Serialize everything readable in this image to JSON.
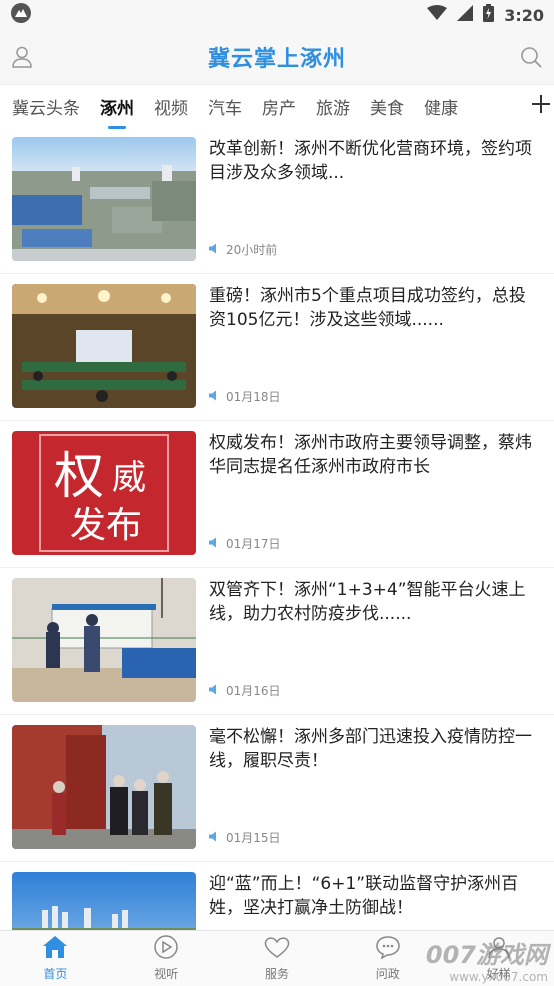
{
  "status_bar": {
    "time": "3:20"
  },
  "header": {
    "title": "冀云掌上涿州"
  },
  "tabs": [
    "冀云头条",
    "涿州",
    "视频",
    "汽车",
    "房产",
    "旅游",
    "美食",
    "健康"
  ],
  "articles": [
    {
      "title": "改革创新！涿州不断优化营商环境，签约项目涉及众多领域...",
      "time": "20小时前",
      "thumb_icon": "aerial-industrial-park-photo"
    },
    {
      "title": "重磅！涿州市5个重点项目成功签约，总投资105亿元！涉及这些领域......",
      "time": "01月18日",
      "thumb_icon": "conference-hall-photo"
    },
    {
      "title": "权威发布！涿州市政府主要领导调整，蔡炜华同志提名任涿州市政府市长",
      "time": "01月17日",
      "thumb_icon": "authority-release-banner",
      "thumb_text": [
        "权",
        "威",
        "发布"
      ]
    },
    {
      "title": "双管齐下！涿州“1+3+4”智能平台火速上线，助力农村防疫步伐......",
      "time": "01月16日",
      "thumb_icon": "village-checkpoint-photo"
    },
    {
      "title": "毫不松懈！涿州多部门迅速投入疫情防控一线，履职尽责！",
      "time": "01月15日",
      "thumb_icon": "street-inspection-photo"
    },
    {
      "title": "迎“蓝”而上！“6+1”联动监督守护涿州百姓，坚决打赢净土防御战！",
      "time": "",
      "thumb_icon": "city-skyline-photo"
    }
  ],
  "bottom_nav": [
    {
      "label": "首页",
      "icon": "home-icon",
      "active": true
    },
    {
      "label": "视听",
      "icon": "play-icon",
      "active": false
    },
    {
      "label": "服务",
      "icon": "heart-icon",
      "active": false
    },
    {
      "label": "问政",
      "icon": "chat-icon",
      "active": false
    },
    {
      "label": "好样",
      "icon": "user-icon",
      "active": false
    }
  ],
  "watermark": {
    "big": "007游戏网",
    "small": "www.yx007.com"
  },
  "colors": {
    "accent": "#2f8fe0",
    "banner_red": "#c4272e"
  }
}
